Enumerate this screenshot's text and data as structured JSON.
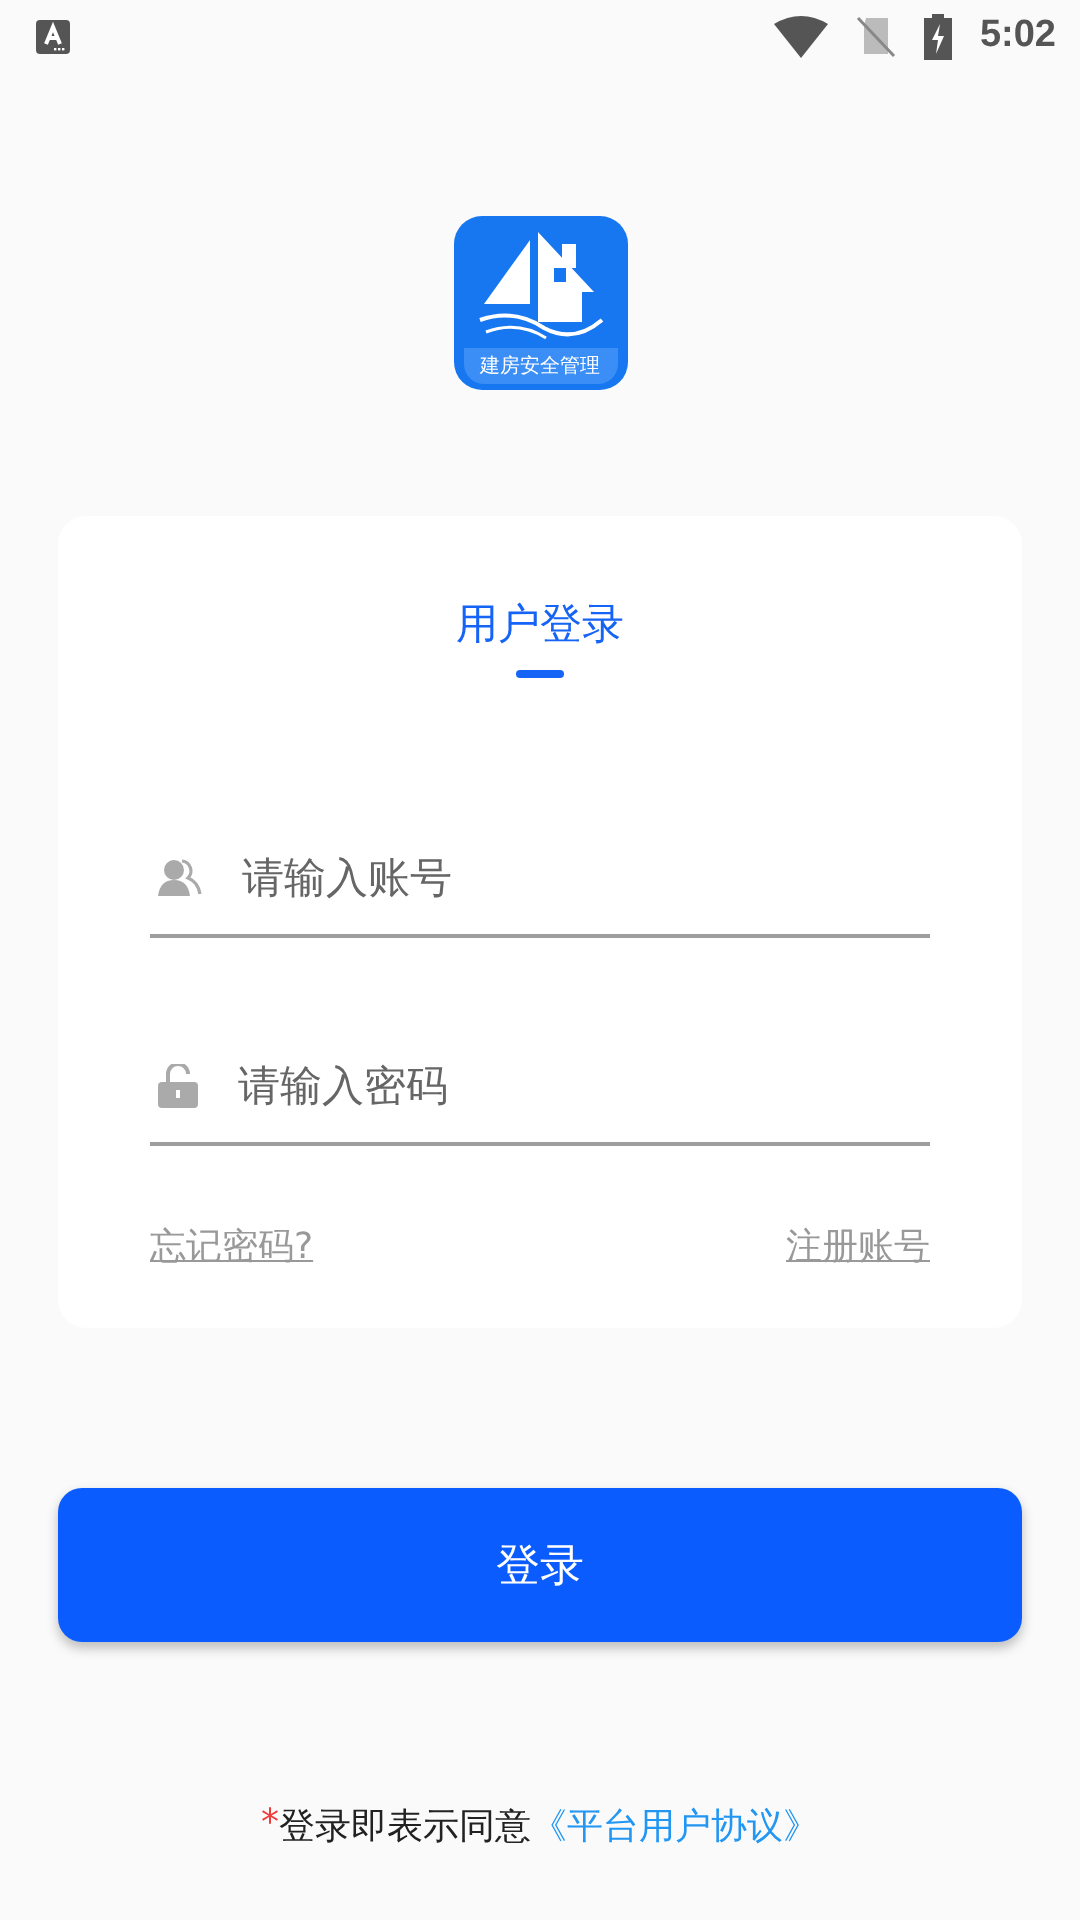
{
  "status_bar": {
    "time": "5:02"
  },
  "logo": {
    "caption": "建房安全管理"
  },
  "login_card": {
    "tabs": [
      {
        "label": "用户登录",
        "selected": true
      }
    ],
    "fields": [
      {
        "kind": "account",
        "placeholder": "请输入账号"
      },
      {
        "kind": "password",
        "placeholder": "请输入密码"
      }
    ],
    "links": [
      "忘记密码?",
      "注册账号"
    ]
  },
  "login_button": "登录",
  "agreement": {
    "required_mark": "*",
    "text": "登录即表示同意",
    "link": "《平台用户协议》"
  }
}
